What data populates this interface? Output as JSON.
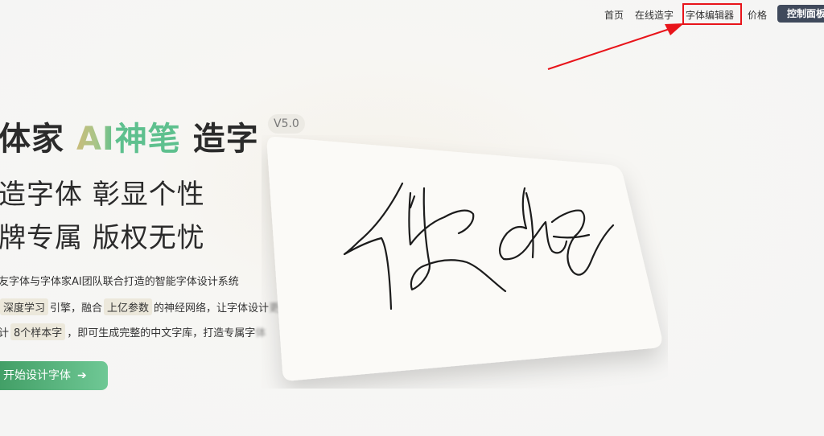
{
  "nav": {
    "home": "首页",
    "online_font": "在线造字",
    "font_editor": "字体编辑器",
    "pricing": "价格",
    "control_panel": "控制面板"
  },
  "hero": {
    "title_part1": "体家",
    "title_ai": "AI",
    "title_brush": "神笔",
    "title_part2": "造字",
    "version": "V5.0",
    "slogan_line1": "造字体 彰显个性",
    "slogan_line2": "牌专属 版权无忧",
    "desc_line1": "友字体与字体家AI团队联合打造的智能字体设计系统",
    "desc_line2_a": "深度学习",
    "desc_line2_b": "引擎，融合",
    "desc_line2_c": "上亿参数",
    "desc_line2_d": "的神经网络，让字体设计",
    "desc_line2_e": "更智能",
    "desc_line3_a": "计",
    "desc_line3_b": "8个样本字",
    "desc_line3_c": "，即可生成完整的中文字库，打造专属字",
    "desc_line3_d": "体",
    "cta_label": "开始设计字体",
    "cta_icon": "arrow-right-icon"
  },
  "card": {
    "handwriting_text": "你好"
  },
  "colors": {
    "accent_green": "#5ec08e",
    "annotation_red": "#e8141a",
    "button_dark": "#404a5c"
  }
}
